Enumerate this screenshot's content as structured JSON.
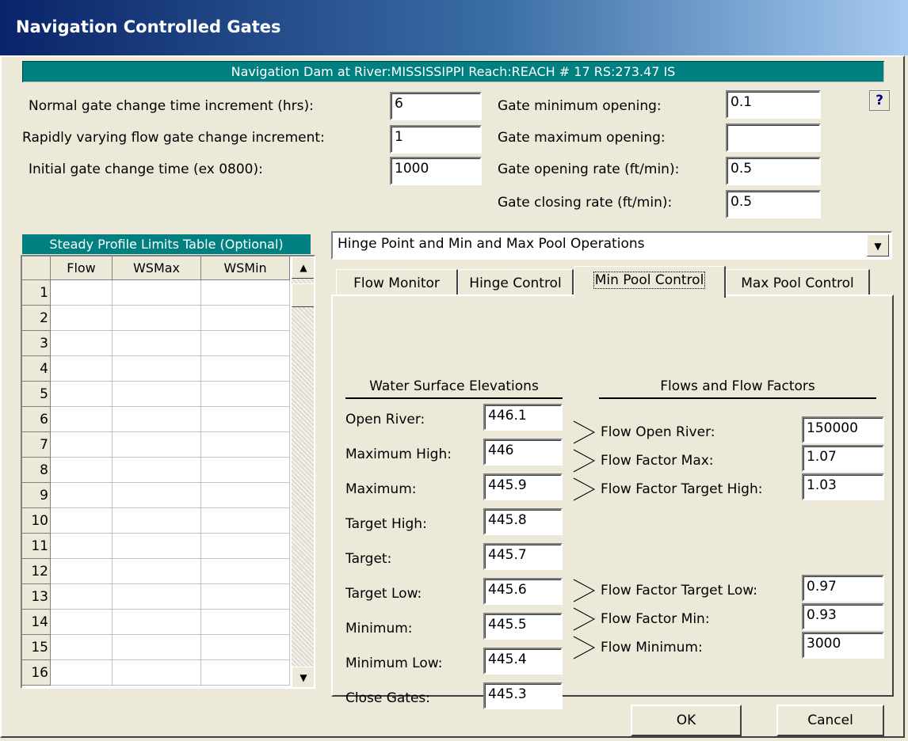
{
  "window": {
    "title": "Navigation Controlled Gates"
  },
  "banner": "Navigation Dam at River:MISSISSIPPI Reach:REACH # 17 RS:273.47   IS",
  "gate_settings": {
    "normal_increment_label": "Normal gate change time increment (hrs):",
    "normal_increment_value": "6",
    "rapid_increment_label": "Rapidly varying flow gate change increment:",
    "rapid_increment_value": "1",
    "initial_time_label": "Initial gate change time (ex 0800):",
    "initial_time_value": "1000",
    "min_opening_label": "Gate minimum opening:",
    "min_opening_value": "0.1",
    "max_opening_label": "Gate maximum opening:",
    "max_opening_value": "",
    "opening_rate_label": "Gate opening rate (ft/min):",
    "opening_rate_value": "0.5",
    "closing_rate_label": "Gate closing rate (ft/min):",
    "closing_rate_value": "0.5"
  },
  "help_button": "?",
  "steady_table": {
    "title": "Steady Profile Limits Table (Optional)",
    "columns": [
      "Flow",
      "WSMax",
      "WSMin"
    ],
    "row_numbers": [
      "1",
      "2",
      "3",
      "4",
      "5",
      "6",
      "7",
      "8",
      "9",
      "10",
      "11",
      "12",
      "13",
      "14",
      "15",
      "16"
    ]
  },
  "operation_select": {
    "value": "Hinge Point and Min and Max Pool Operations"
  },
  "tabs": [
    {
      "label": "Flow Monitor"
    },
    {
      "label": "Hinge Control"
    },
    {
      "label": "Min Pool Control"
    },
    {
      "label": "Max Pool Control"
    }
  ],
  "active_tab": "Min Pool Control",
  "min_pool": {
    "wse_header": "Water Surface Elevations",
    "flows_header": "Flows and Flow Factors",
    "wse": [
      {
        "label": "Open River:",
        "value": "446.1"
      },
      {
        "label": "Maximum High:",
        "value": "446"
      },
      {
        "label": "Maximum:",
        "value": "445.9"
      },
      {
        "label": "Target High:",
        "value": "445.8"
      },
      {
        "label": "Target:",
        "value": "445.7"
      },
      {
        "label": "Target Low:",
        "value": "445.6"
      },
      {
        "label": "Minimum:",
        "value": "445.5"
      },
      {
        "label": "Minimum Low:",
        "value": "445.4"
      },
      {
        "label": "Close Gates:",
        "value": "445.3"
      }
    ],
    "flows": [
      {
        "label": "Flow Open River:",
        "value": "150000"
      },
      {
        "label": "Flow Factor Max:",
        "value": "1.07"
      },
      {
        "label": "Flow Factor Target High:",
        "value": "1.03"
      },
      {
        "label": "Flow Factor Target Low:",
        "value": "0.97"
      },
      {
        "label": "Flow Factor Min:",
        "value": "0.93"
      },
      {
        "label": "Flow Minimum:",
        "value": "3000"
      }
    ]
  },
  "buttons": {
    "ok": "OK",
    "cancel": "Cancel"
  }
}
